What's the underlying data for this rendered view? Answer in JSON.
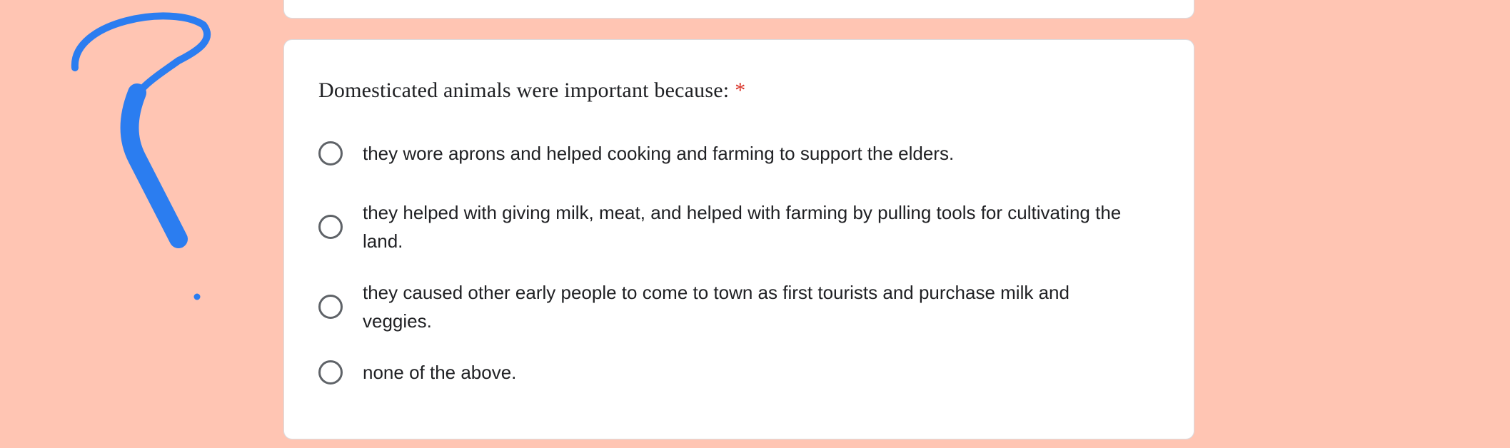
{
  "question": {
    "title": "Domesticated animals were important because:",
    "required_marker": "*",
    "options": [
      {
        "label": "they wore aprons and helped cooking and farming to support the elders."
      },
      {
        "label": "they helped with giving milk, meat, and helped with farming by pulling tools for cultivating the land."
      },
      {
        "label": "they caused other early people to come to town as first tourists and purchase milk and veggies."
      },
      {
        "label": "none of the above."
      }
    ]
  },
  "colors": {
    "background": "#ffc5b3",
    "card": "#ffffff",
    "doodle": "#2b7df0",
    "required": "#d93025",
    "radio_border": "#5f6368"
  },
  "doodle": {
    "icon": "question-mark-drawing"
  }
}
